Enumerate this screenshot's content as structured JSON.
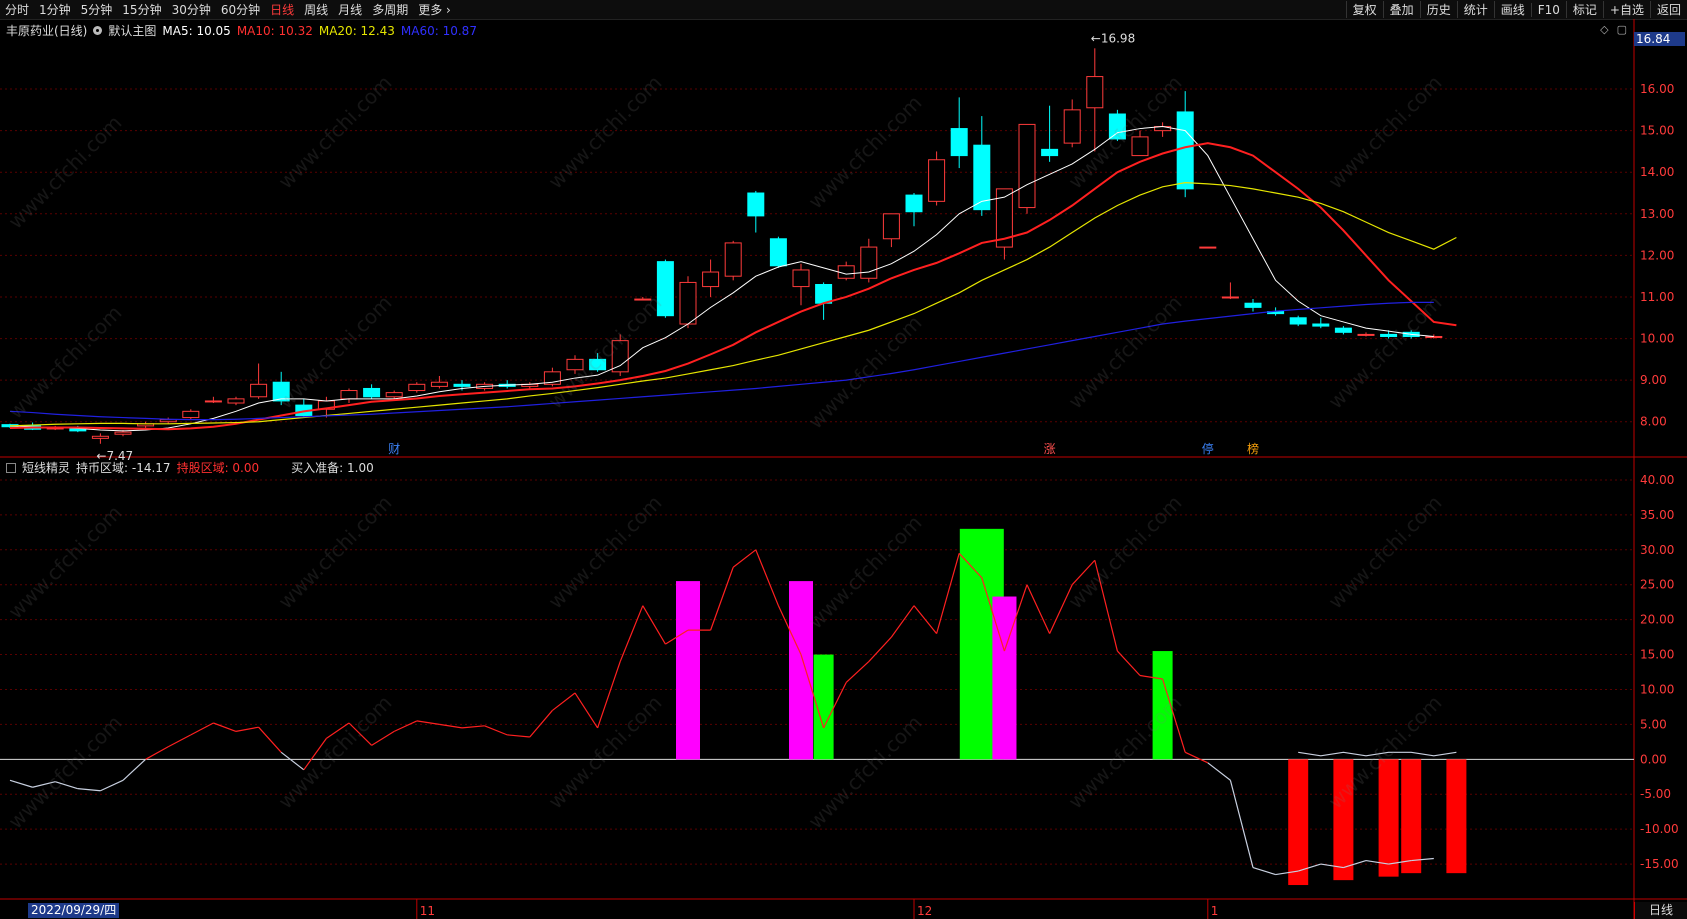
{
  "toolbar": {
    "left_items": [
      "分时",
      "1分钟",
      "5分钟",
      "15分钟",
      "30分钟",
      "60分钟",
      "日线",
      "周线",
      "月线",
      "多周期",
      "更多 ›"
    ],
    "active": "日线",
    "right_items": [
      "复权",
      "叠加",
      "历史",
      "统计",
      "画线",
      "F10",
      "标记",
      "+自选",
      "返回"
    ]
  },
  "main_legend": {
    "name": "丰原药业(日线)",
    "template": "默认主图",
    "ma5": "MA5: 10.05",
    "ma10": "MA10: 10.32",
    "ma20": "MA20: 12.43",
    "ma60": "MA60: 10.87"
  },
  "sub_legend": {
    "name": "短线精灵",
    "hold_coin": "持币区域: -14.17",
    "hold_stock": "持股区域: 0.00",
    "buy_ready": "买入准备: 1.00"
  },
  "current_price_tag": "16.84",
  "bottom_period": "日线",
  "cursor_date": "2022/09/29/四",
  "colors": {
    "up": "#ff3b3b",
    "down": "#00ffff",
    "ma5": "#ffffff",
    "ma10": "#ff2020",
    "ma20": "#e5e500",
    "ma60": "#2020e0",
    "magenta": "#ff00ff",
    "green": "#00ff00",
    "grid": "#5a0000",
    "axis": "#c00000"
  },
  "watermark_text": "www.cfchi.com",
  "chart_data": [
    {
      "type": "candlestick",
      "title": "丰原药业(日线)",
      "ylim": [
        7.2,
        17.3
      ],
      "y_ticks": [
        8.0,
        9.0,
        10.0,
        11.0,
        12.0,
        13.0,
        14.0,
        15.0,
        16.0
      ],
      "x_month_labels": [
        {
          "i": 18,
          "label": "11"
        },
        {
          "i": 40,
          "label": "12"
        },
        {
          "i": 53,
          "label": "1"
        }
      ],
      "annotations": [
        {
          "i": 4,
          "text": "←7.47",
          "value": 7.47
        },
        {
          "i": 48,
          "text": "←16.98",
          "value": 16.98
        }
      ],
      "event_tags": [
        {
          "i": 17,
          "text": "财",
          "color": "#3b82f6"
        },
        {
          "i": 46,
          "text": "涨",
          "color": "#ff5050"
        },
        {
          "i": 53,
          "text": "停",
          "color": "#3b82f6"
        },
        {
          "i": 55,
          "text": "榜",
          "color": "#f59e0b"
        }
      ],
      "ohlc": [
        [
          7.93,
          7.95,
          7.85,
          7.88
        ],
        [
          7.9,
          7.98,
          7.8,
          7.82
        ],
        [
          7.85,
          7.9,
          7.8,
          7.85
        ],
        [
          7.85,
          7.9,
          7.75,
          7.78
        ],
        [
          7.6,
          7.72,
          7.47,
          7.65
        ],
        [
          7.7,
          7.8,
          7.65,
          7.75
        ],
        [
          7.9,
          8.0,
          7.85,
          7.95
        ],
        [
          8.0,
          8.1,
          7.95,
          8.05
        ],
        [
          8.1,
          8.3,
          8.05,
          8.25
        ],
        [
          8.5,
          8.6,
          8.45,
          8.5
        ],
        [
          8.45,
          8.6,
          8.4,
          8.55
        ],
        [
          8.6,
          9.4,
          8.55,
          8.9
        ],
        [
          8.95,
          9.2,
          8.4,
          8.5
        ],
        [
          8.4,
          8.55,
          8.1,
          8.15
        ],
        [
          8.3,
          8.6,
          8.1,
          8.5
        ],
        [
          8.55,
          8.8,
          8.45,
          8.75
        ],
        [
          8.8,
          8.9,
          8.55,
          8.6
        ],
        [
          8.6,
          8.75,
          8.5,
          8.7
        ],
        [
          8.75,
          8.95,
          8.7,
          8.9
        ],
        [
          8.85,
          9.1,
          8.8,
          8.95
        ],
        [
          8.9,
          9.0,
          8.75,
          8.85
        ],
        [
          8.8,
          8.95,
          8.75,
          8.9
        ],
        [
          8.9,
          9.0,
          8.8,
          8.85
        ],
        [
          8.85,
          8.95,
          8.8,
          8.9
        ],
        [
          8.9,
          9.3,
          8.85,
          9.2
        ],
        [
          9.25,
          9.6,
          9.15,
          9.5
        ],
        [
          9.5,
          9.65,
          9.2,
          9.25
        ],
        [
          9.2,
          10.1,
          9.1,
          9.95
        ],
        [
          10.95,
          11.0,
          10.95,
          10.95
        ],
        [
          11.85,
          11.9,
          10.5,
          10.55
        ],
        [
          10.35,
          11.5,
          10.25,
          11.35
        ],
        [
          11.25,
          11.9,
          11.0,
          11.6
        ],
        [
          11.5,
          12.35,
          11.4,
          12.3
        ],
        [
          13.5,
          13.55,
          12.55,
          12.95
        ],
        [
          12.4,
          12.45,
          11.7,
          11.75
        ],
        [
          11.25,
          11.8,
          10.8,
          11.65
        ],
        [
          11.3,
          11.35,
          10.45,
          10.85
        ],
        [
          11.45,
          11.85,
          11.4,
          11.75
        ],
        [
          11.45,
          12.4,
          11.35,
          12.2
        ],
        [
          12.4,
          13.0,
          12.2,
          13.0
        ],
        [
          13.45,
          13.5,
          12.7,
          13.05
        ],
        [
          13.3,
          14.5,
          13.2,
          14.3
        ],
        [
          15.05,
          15.8,
          14.1,
          14.4
        ],
        [
          14.65,
          15.35,
          12.95,
          13.1
        ],
        [
          12.2,
          13.6,
          11.9,
          13.6
        ],
        [
          13.15,
          15.15,
          13.0,
          15.15
        ],
        [
          14.55,
          15.6,
          14.25,
          14.4
        ],
        [
          14.7,
          15.75,
          14.6,
          15.5
        ],
        [
          15.55,
          16.98,
          14.5,
          16.3
        ],
        [
          15.4,
          15.5,
          14.75,
          14.8
        ],
        [
          14.4,
          15.0,
          14.4,
          14.85
        ],
        [
          15.0,
          15.2,
          14.85,
          15.1
        ],
        [
          15.45,
          15.95,
          13.4,
          13.6
        ],
        [
          12.2,
          12.2,
          12.2,
          12.2
        ],
        [
          11.0,
          11.35,
          10.95,
          11.0
        ],
        [
          10.85,
          10.95,
          10.65,
          10.75
        ],
        [
          10.65,
          10.75,
          10.55,
          10.6
        ],
        [
          10.5,
          10.55,
          10.3,
          10.35
        ],
        [
          10.35,
          10.5,
          10.25,
          10.3
        ],
        [
          10.25,
          10.3,
          10.1,
          10.15
        ],
        [
          10.1,
          10.15,
          10.05,
          10.1
        ],
        [
          10.1,
          10.2,
          10.0,
          10.05
        ],
        [
          10.15,
          10.2,
          10.0,
          10.05
        ],
        [
          10.05,
          10.1,
          10.0,
          10.05
        ]
      ],
      "series": [
        {
          "name": "MA5",
          "values": [
            7.9,
            7.88,
            7.86,
            7.84,
            7.8,
            7.78,
            7.8,
            7.85,
            7.95,
            8.08,
            8.25,
            8.45,
            8.55,
            8.55,
            8.5,
            8.55,
            8.55,
            8.55,
            8.62,
            8.72,
            8.8,
            8.85,
            8.88,
            8.9,
            8.95,
            9.05,
            9.12,
            9.35,
            9.78,
            10.02,
            10.35,
            10.75,
            11.1,
            11.5,
            11.72,
            11.85,
            11.7,
            11.55,
            11.6,
            11.8,
            12.1,
            12.5,
            13.0,
            13.3,
            13.4,
            13.7,
            13.95,
            14.2,
            14.55,
            14.95,
            15.05,
            15.1,
            15.0,
            14.4,
            13.4,
            12.4,
            11.4,
            10.9,
            10.55,
            10.4,
            10.25,
            10.18,
            10.1,
            10.05
          ]
        },
        {
          "name": "MA10",
          "values": [
            7.85,
            7.86,
            7.86,
            7.86,
            7.85,
            7.84,
            7.83,
            7.82,
            7.84,
            7.88,
            7.95,
            8.05,
            8.15,
            8.25,
            8.32,
            8.4,
            8.48,
            8.52,
            8.56,
            8.62,
            8.66,
            8.7,
            8.74,
            8.78,
            8.8,
            8.85,
            8.92,
            9.0,
            9.1,
            9.22,
            9.4,
            9.62,
            9.85,
            10.15,
            10.4,
            10.65,
            10.85,
            11.0,
            11.2,
            11.45,
            11.65,
            11.82,
            12.05,
            12.3,
            12.4,
            12.55,
            12.85,
            13.2,
            13.6,
            14.0,
            14.25,
            14.45,
            14.6,
            14.7,
            14.6,
            14.4,
            14.0,
            13.6,
            13.15,
            12.6,
            12.0,
            11.4,
            10.9,
            10.4,
            10.32
          ]
        },
        {
          "name": "MA20",
          "values": [
            7.9,
            7.92,
            7.94,
            7.95,
            7.96,
            7.96,
            7.95,
            7.95,
            7.96,
            7.97,
            7.98,
            8.0,
            8.05,
            8.1,
            8.15,
            8.2,
            8.25,
            8.3,
            8.35,
            8.4,
            8.45,
            8.5,
            8.55,
            8.62,
            8.68,
            8.75,
            8.82,
            8.9,
            8.98,
            9.05,
            9.15,
            9.25,
            9.35,
            9.48,
            9.6,
            9.75,
            9.9,
            10.05,
            10.2,
            10.4,
            10.6,
            10.85,
            11.1,
            11.4,
            11.65,
            11.9,
            12.2,
            12.55,
            12.9,
            13.2,
            13.45,
            13.65,
            13.75,
            13.72,
            13.68,
            13.6,
            13.5,
            13.4,
            13.25,
            13.05,
            12.8,
            12.55,
            12.35,
            12.15,
            12.43
          ]
        },
        {
          "name": "MA60",
          "values": [
            8.25,
            8.22,
            8.18,
            8.15,
            8.12,
            8.1,
            8.08,
            8.06,
            8.05,
            8.05,
            8.06,
            8.08,
            8.1,
            8.12,
            8.14,
            8.16,
            8.18,
            8.21,
            8.24,
            8.27,
            8.3,
            8.33,
            8.36,
            8.4,
            8.44,
            8.48,
            8.52,
            8.56,
            8.6,
            8.64,
            8.68,
            8.72,
            8.76,
            8.8,
            8.85,
            8.9,
            8.95,
            9.0,
            9.08,
            9.16,
            9.25,
            9.35,
            9.45,
            9.55,
            9.65,
            9.75,
            9.85,
            9.95,
            10.05,
            10.15,
            10.25,
            10.35,
            10.42,
            10.48,
            10.54,
            10.6,
            10.66,
            10.7,
            10.74,
            10.78,
            10.82,
            10.85,
            10.87,
            10.87
          ]
        }
      ]
    },
    {
      "type": "bar",
      "title": "短线精灵",
      "ylim": [
        -20,
        43
      ],
      "y_ticks": [
        -15.0,
        -10.0,
        -5.0,
        0.0,
        5.0,
        10.0,
        15.0,
        20.0,
        25.0,
        30.0,
        35.0,
        40.0
      ],
      "line_values": [
        -3.0,
        -4.0,
        -3.2,
        -4.2,
        -4.5,
        -3.0,
        0.0,
        1.8,
        3.5,
        5.2,
        4.0,
        4.6,
        1.0,
        -1.5,
        3.0,
        5.2,
        2.0,
        4.0,
        5.5,
        5.0,
        4.5,
        4.8,
        3.5,
        3.2,
        7.0,
        9.5,
        4.5,
        14.0,
        22.0,
        16.5,
        18.5,
        18.5,
        27.5,
        30.0,
        22.0,
        15.0,
        4.5,
        11.0,
        14.0,
        17.5,
        22.0,
        18.0,
        29.5,
        26.0,
        15.5,
        25.0,
        18.0,
        25.0,
        28.5,
        15.5,
        12.0,
        11.5,
        1.0,
        -0.5,
        -3.0,
        -15.5,
        -16.5,
        -16.0,
        -15.0,
        -15.5,
        -14.5,
        -15.0,
        -14.5,
        -14.2
      ],
      "line_above_color": "#ff2020",
      "line_below_color": "#c8d0e0",
      "bars_magenta": [
        {
          "i": 30,
          "value": 25.5
        },
        {
          "i": 35,
          "value": 25.5
        },
        {
          "i": 44,
          "value": 23.3
        }
      ],
      "bars_green": [
        {
          "i": 36,
          "value": 15.0
        },
        {
          "i": 43,
          "value": 33.0
        },
        {
          "i": 51,
          "value": 15.5
        }
      ],
      "bars_red": [
        {
          "i": 57,
          "value": -18.0
        },
        {
          "i": 59,
          "value": -17.3
        },
        {
          "i": 61,
          "value": -16.8
        },
        {
          "i": 62,
          "value": -16.3
        },
        {
          "i": 64,
          "value": -16.3
        }
      ],
      "small_marks_above_zero": [
        {
          "i": 57,
          "value": 1.0
        },
        {
          "i": 58,
          "value": 0.5
        },
        {
          "i": 59,
          "value": 1.0
        },
        {
          "i": 60,
          "value": 0.5
        },
        {
          "i": 61,
          "value": 1.0
        },
        {
          "i": 62,
          "value": 1.0
        },
        {
          "i": 63,
          "value": 0.5
        },
        {
          "i": 64,
          "value": 1.0
        }
      ]
    }
  ]
}
